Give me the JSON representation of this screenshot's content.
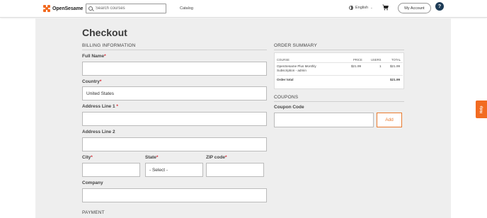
{
  "header": {
    "logo_text": "OpenSesame",
    "search_placeholder": "Search courses",
    "nav_catalog": "Catalog",
    "language": "English",
    "account_label": "My Account",
    "help_symbol": "?",
    "brand_color": "#f26b21"
  },
  "page": {
    "title": "Checkout"
  },
  "billing": {
    "heading": "BILLING INFORMATION",
    "full_name_label": "Full Name",
    "country_label": "Country",
    "country_value": "United States",
    "address1_label": "Address Line 1",
    "address2_label": "Address Line 2",
    "city_label": "City",
    "state_label": "State",
    "state_value": "- Select -",
    "zip_label": "ZIP code",
    "company_label": "Company",
    "required_mark": "*"
  },
  "payment": {
    "heading": "PAYMENT"
  },
  "order_summary": {
    "heading": "ORDER SUMMARY",
    "columns": [
      "COURSE",
      "PRICE",
      "USERS",
      "TOTAL"
    ],
    "rows": [
      {
        "course_line1": "OpenSesame Plus Monthly",
        "course_line2": "Subscription - admin",
        "price": "$21.99",
        "users": "1",
        "total": "$21.99"
      }
    ],
    "order_total_label": "Order total",
    "order_total_value": "$21.99"
  },
  "coupons": {
    "heading": "COUPONS",
    "code_label": "Coupon Code",
    "add_label": "Add"
  },
  "help_tab": {
    "label": "Help"
  }
}
